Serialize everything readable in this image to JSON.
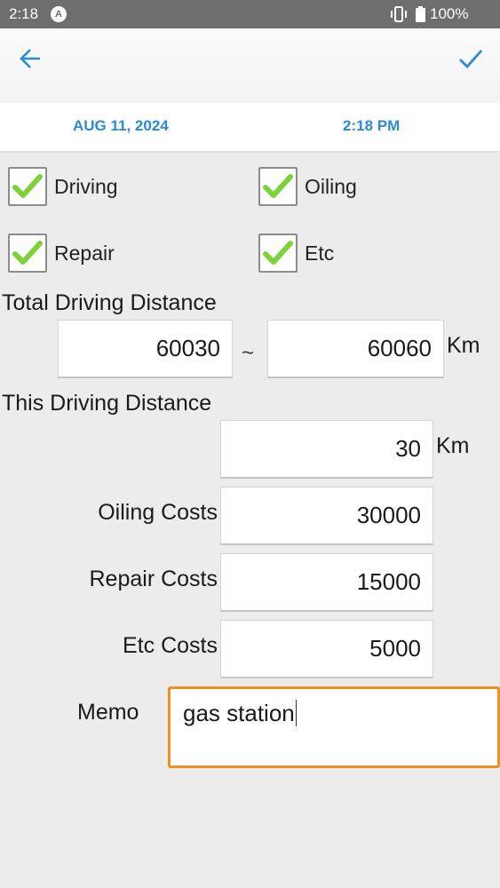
{
  "status_bar": {
    "time": "2:18",
    "battery": "100%"
  },
  "app_bar": {
    "back_icon": "arrow-left-icon",
    "confirm_icon": "checkmark-icon",
    "accent_color": "#2a8ad8"
  },
  "date_bar": {
    "date": "AUG 11, 2024",
    "time": "2:18 PM"
  },
  "categories": [
    {
      "label": "Driving",
      "checked": true
    },
    {
      "label": "Oiling",
      "checked": true
    },
    {
      "label": "Repair",
      "checked": true
    },
    {
      "label": "Etc",
      "checked": true
    }
  ],
  "total_distance": {
    "label": "Total Driving Distance",
    "from": "60030",
    "separator": "~",
    "to": "60060",
    "unit": "Km"
  },
  "this_distance": {
    "label": "This Driving Distance",
    "value": "30",
    "unit": "Km"
  },
  "costs": [
    {
      "label": "Oiling Costs",
      "value": "30000"
    },
    {
      "label": "Repair Costs",
      "value": "15000"
    },
    {
      "label": "Etc Costs",
      "value": "5000"
    }
  ],
  "memo": {
    "label": "Memo",
    "value": "gas station",
    "focus_color": "#f0901e"
  }
}
